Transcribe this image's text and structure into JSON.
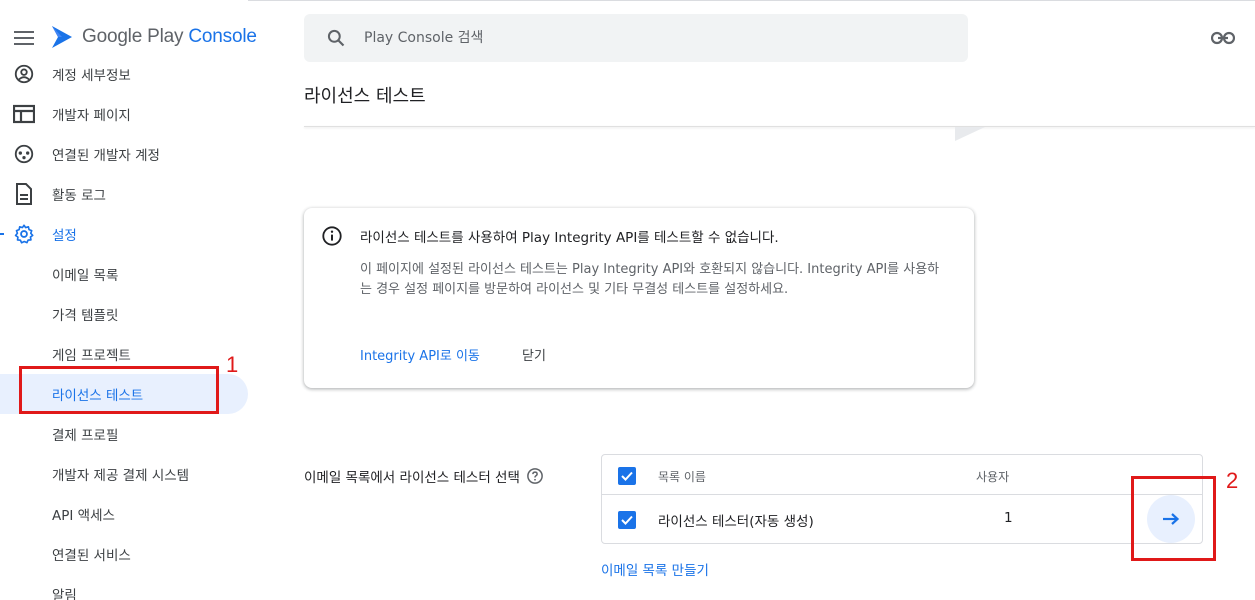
{
  "header": {
    "logo_google_play": "Google Play",
    "logo_console": "Console",
    "search_placeholder": "Play Console 검색"
  },
  "sidebar": {
    "items": [
      {
        "label": "계정 세부정보",
        "icon": "account-circle-icon"
      },
      {
        "label": "개발자 페이지",
        "icon": "web-icon"
      },
      {
        "label": "연결된 개발자 계정",
        "icon": "linked-accounts-icon"
      },
      {
        "label": "활동 로그",
        "icon": "document-icon"
      },
      {
        "label": "설정",
        "icon": "gear-icon"
      }
    ],
    "sub_items": [
      {
        "label": "이메일 목록"
      },
      {
        "label": "가격 템플릿"
      },
      {
        "label": "게임 프로젝트"
      },
      {
        "label": "라이선스 테스트"
      },
      {
        "label": "결제 프로필"
      },
      {
        "label": "개발자 제공 결제 시스템"
      },
      {
        "label": "API 액세스"
      },
      {
        "label": "연결된 서비스"
      },
      {
        "label": "알림"
      }
    ]
  },
  "main": {
    "title": "라이선스 테스트",
    "alert": {
      "title": "라이선스 테스트를 사용하여 Play Integrity API를 테스트할 수 없습니다.",
      "body": "이 페이지에 설정된 라이선스 테스트는 Play Integrity API와 호환되지 않습니다. Integrity API를 사용하는 경우 설정 페이지를 방문하여 라이선스 및 기타 무결성 테스트를 설정하세요.",
      "link": "Integrity API로 이동",
      "close": "닫기"
    },
    "select_label": "이메일 목록에서 라이선스 테스터 선택",
    "table": {
      "col_name": "목록 이름",
      "col_users": "사용자",
      "rows": [
        {
          "name": "라이선스 테스터(자동 생성)",
          "users": "1",
          "checked": true
        }
      ]
    },
    "create_link": "이메일 목록 만들기"
  },
  "annotations": {
    "num1": "1",
    "num2": "2"
  },
  "colors": {
    "accent": "#1a73e8",
    "annotation": "#e01919"
  }
}
